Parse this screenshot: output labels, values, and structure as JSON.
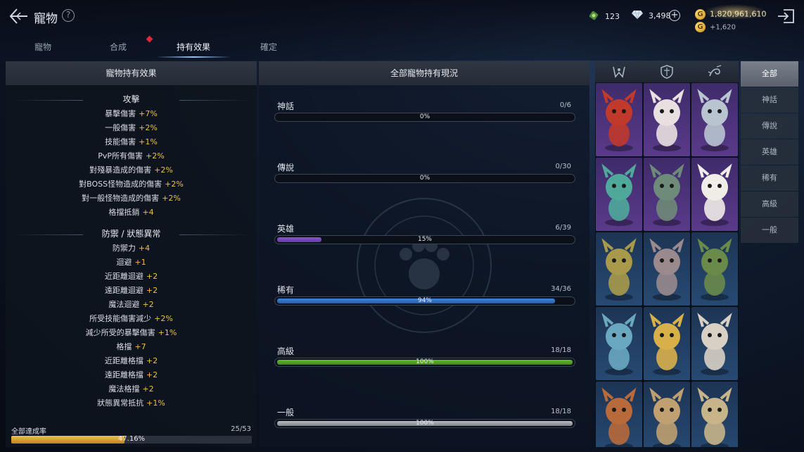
{
  "header": {
    "title": "寵物",
    "help": "?",
    "currencies": [
      {
        "icon": "sprout-ticket-icon",
        "value": "123"
      },
      {
        "icon": "diamond-icon",
        "value": "3,498"
      }
    ],
    "gold": {
      "icon": "G",
      "value": "1,820,961,610",
      "sub_icon": "G",
      "sub_value": "+1,620"
    }
  },
  "tabs": [
    {
      "label": "寵物"
    },
    {
      "label": "合成"
    },
    {
      "label": "持有效果"
    },
    {
      "label": "確定"
    }
  ],
  "left": {
    "header": "寵物持有效果",
    "sections": [
      {
        "title": "攻擊",
        "effects": [
          {
            "name": "暴擊傷害",
            "value": "+7%"
          },
          {
            "name": "一般傷害",
            "value": "+2%"
          },
          {
            "name": "技能傷害",
            "value": "+1%"
          },
          {
            "name": "PvP所有傷害",
            "value": "+2%"
          },
          {
            "name": "對殘暴造成的傷害",
            "value": "+2%"
          },
          {
            "name": "對BOSS怪物造成的傷害",
            "value": "+2%"
          },
          {
            "name": "對一般怪物造成的傷害",
            "value": "+2%"
          },
          {
            "name": "格擋抵銷",
            "value": "+4"
          }
        ]
      },
      {
        "title": "防禦 / 狀態異常",
        "effects": [
          {
            "name": "防禦力",
            "value": "+4"
          },
          {
            "name": "迴避",
            "value": "+1"
          },
          {
            "name": "近距離迴避",
            "value": "+2"
          },
          {
            "name": "遠距離迴避",
            "value": "+2"
          },
          {
            "name": "魔法迴避",
            "value": "+2"
          },
          {
            "name": "所受技能傷害減少",
            "value": "+2%"
          },
          {
            "name": "減少所受的暴擊傷害",
            "value": "+1%"
          },
          {
            "name": "格擋",
            "value": "+7"
          },
          {
            "name": "近距離格擋",
            "value": "+2"
          },
          {
            "name": "遠距離格擋",
            "value": "+2"
          },
          {
            "name": "魔法格擋",
            "value": "+2"
          },
          {
            "name": "狀態異常抵抗",
            "value": "+1%"
          }
        ]
      }
    ],
    "completion": {
      "label": "全部達成率",
      "count": "25/53",
      "percent_label": "47.16%",
      "fraction": 0.4716
    }
  },
  "middle": {
    "header": "全部寵物持有現況",
    "grades": [
      {
        "name": "神話",
        "count": "0/6",
        "percent_label": "0%",
        "fraction": 0,
        "color": "#8a5ce6"
      },
      {
        "name": "傳說",
        "count": "0/30",
        "percent_label": "0%",
        "fraction": 0,
        "color": "#e0a030"
      },
      {
        "name": "英雄",
        "count": "6/39",
        "percent_label": "15%",
        "fraction": 0.15,
        "color": "#8a54d8"
      },
      {
        "name": "稀有",
        "count": "34/36",
        "percent_label": "94%",
        "fraction": 0.94,
        "color": "#3a86e0"
      },
      {
        "name": "高級",
        "count": "18/18",
        "percent_label": "100%",
        "fraction": 1.0,
        "color": "#5fbf2a"
      },
      {
        "name": "一般",
        "count": "18/18",
        "percent_label": "100%",
        "fraction": 1.0,
        "color": "#b8bcc2"
      }
    ]
  },
  "pets": {
    "tab_icons": [
      "claw-crest-icon",
      "shield-crest-icon",
      "swirl-crest-icon"
    ],
    "cards": [
      {
        "icon": "red-dragon-pet-icon",
        "grade": "hero",
        "color": "#c0392b"
      },
      {
        "icon": "horned-goat-pet-icon",
        "grade": "hero",
        "color": "#e8e0e0"
      },
      {
        "icon": "silver-armor-pet-icon",
        "grade": "hero",
        "color": "#b8c4d0"
      },
      {
        "icon": "green-wyvern-pet-icon",
        "grade": "hero",
        "color": "#4fa89a"
      },
      {
        "icon": "tree-spirit-pet-icon",
        "grade": "hero",
        "color": "#6e8a78"
      },
      {
        "icon": "white-rabbit-pet-icon",
        "grade": "hero",
        "color": "#f0ece8"
      },
      {
        "icon": "boar-pet-icon",
        "grade": "rare",
        "color": "#a89a4a"
      },
      {
        "icon": "helmet-knight-pet-icon",
        "grade": "rare",
        "color": "#9a8a8e"
      },
      {
        "icon": "flower-girl-pet-icon",
        "grade": "rare",
        "color": "#6a8a4a"
      },
      {
        "icon": "blue-beast-pet-icon",
        "grade": "rare",
        "color": "#6aa8c0"
      },
      {
        "icon": "gold-warrior-pet-icon",
        "grade": "rare",
        "color": "#d8b04a"
      },
      {
        "icon": "masked-shaman-pet-icon",
        "grade": "rare",
        "color": "#d8d0c4"
      },
      {
        "icon": "owl-pet-icon",
        "grade": "rare",
        "color": "#b86a3a"
      },
      {
        "icon": "tribal-mask-pet-icon",
        "grade": "rare",
        "color": "#c0a070"
      },
      {
        "icon": "valkyrie-pet-icon",
        "grade": "rare",
        "color": "#c8b48a"
      }
    ]
  },
  "filter": {
    "items": [
      {
        "label": "全部",
        "active": true
      },
      {
        "label": "神話"
      },
      {
        "label": "傳說"
      },
      {
        "label": "英雄"
      },
      {
        "label": "稀有"
      },
      {
        "label": "高級"
      },
      {
        "label": "一般"
      }
    ]
  }
}
